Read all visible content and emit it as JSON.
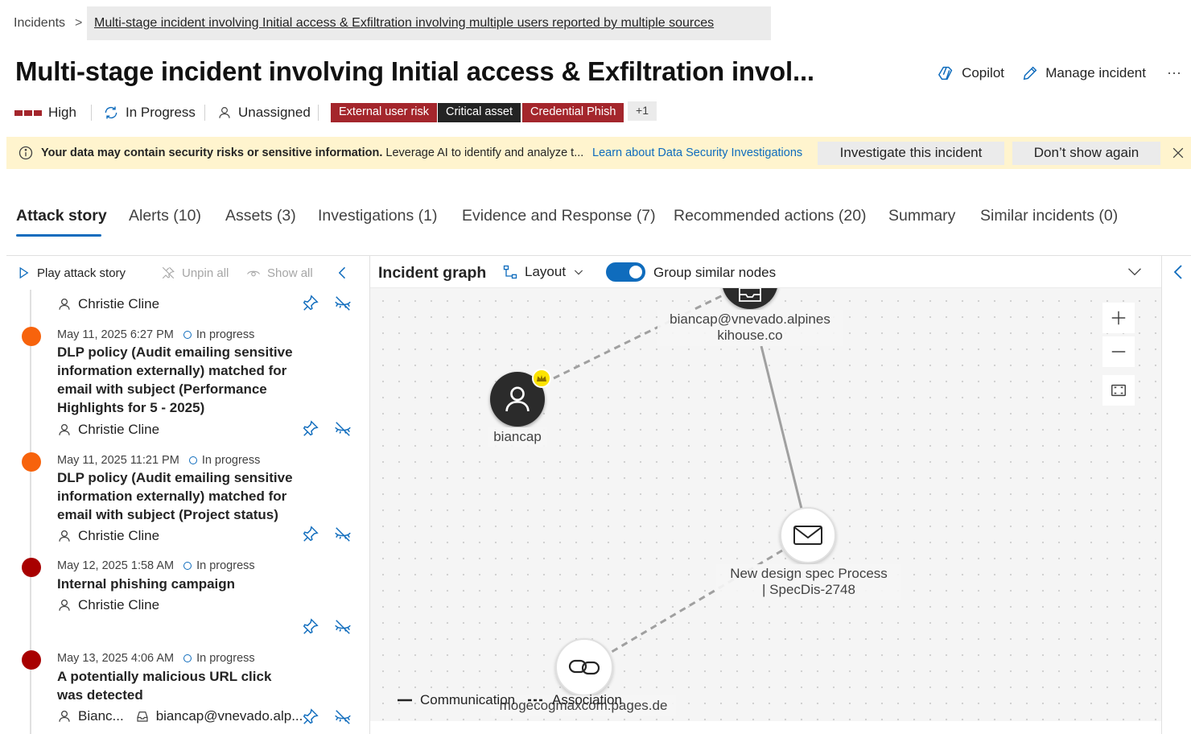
{
  "breadcrumb": {
    "root": "Incidents",
    "separator": ">",
    "current": "Multi-stage incident involving Initial access & Exfiltration involving multiple users reported by multiple sources"
  },
  "header": {
    "title": "Multi-stage incident involving Initial access & Exfiltration invol...",
    "copilot_label": "Copilot",
    "manage_label": "Manage incident",
    "more_label": "···"
  },
  "meta": {
    "severity": "High",
    "status": "In Progress",
    "assignee": "Unassigned",
    "tags": [
      {
        "label": "External user risk",
        "color": "#a4262c"
      },
      {
        "label": "Critical asset",
        "color": "#242424"
      },
      {
        "label": "Credential Phish",
        "color": "#a4262c"
      }
    ],
    "more_tags": "+1"
  },
  "banner": {
    "bold_text": "Your data may contain security risks or sensitive information.",
    "text": " Leverage AI to identify and analyze t...",
    "link": "Learn about Data Security Investigations",
    "investigate_button": "Investigate this incident",
    "dismiss_button": "Don’t show again"
  },
  "tabs": [
    {
      "label": "Attack story",
      "active": true
    },
    {
      "label": "Alerts (10)"
    },
    {
      "label": "Assets (3)"
    },
    {
      "label": "Investigations (1)"
    },
    {
      "label": "Evidence and Response (7)"
    },
    {
      "label": "Recommended actions (20)"
    },
    {
      "label": "Summary"
    },
    {
      "label": "Similar incidents (0)"
    }
  ],
  "left_panel": {
    "play_label": "Play attack story",
    "unpin_label": "Unpin all",
    "show_label": "Show all",
    "top_user": "Christie Cline",
    "alerts": [
      {
        "timestamp": "May 11, 2025 6:27 PM",
        "status": "In progress",
        "title": "DLP policy (Audit emailing sensitive information externally) matched for email with subject (Performance Highlights for 5 - 2025)",
        "user": "Christie Cline",
        "severity_color": "#f7630c"
      },
      {
        "timestamp": "May 11, 2025 11:21 PM",
        "status": "In progress",
        "title": "DLP policy (Audit emailing sensitive information externally) matched for email with subject (Project status)",
        "user": "Christie Cline",
        "severity_color": "#f7630c"
      },
      {
        "timestamp": "May 12, 2025 1:58 AM",
        "status": "In progress",
        "title": "Internal phishing campaign",
        "user": "Christie Cline",
        "severity_color": "#a80000"
      },
      {
        "timestamp": "May 13, 2025 4:06 AM",
        "status": "In progress",
        "title": "A potentially malicious URL click was detected",
        "user": "Bianc...",
        "mailbox": "biancap@vnevado.alp...",
        "severity_color": "#a80000"
      }
    ]
  },
  "graph": {
    "title": "Incident graph",
    "layout_label": "Layout",
    "group_label": "Group similar nodes",
    "nodes": {
      "mailbox": {
        "line1": "biancap@vnevado.alpines",
        "line2": "kihouse.co"
      },
      "user": {
        "label": "biancap"
      },
      "email": {
        "line1": "New design spec Process",
        "line2": "| SpecDis-2748"
      },
      "url": {
        "label": "mogecogmaxcom.pages.de"
      }
    },
    "legend": {
      "communication": "Communication",
      "association": "Association"
    }
  }
}
